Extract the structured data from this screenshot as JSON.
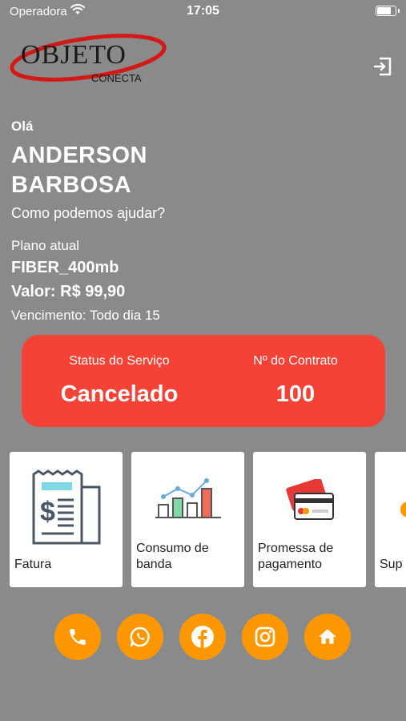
{
  "status_bar": {
    "carrier": "Operadora",
    "time": "17:05",
    "battery_level": 0.9
  },
  "logo": {
    "main": "OBJETO",
    "sub": "CONECTA"
  },
  "greeting": {
    "hello": "Olá",
    "name": "ANDERSON BARBOSA",
    "help": "Como podemos ajudar?"
  },
  "plan": {
    "label": "Plano atual",
    "name": "FIBER_400mb",
    "value": "Valor: R$ 99,90",
    "due": "Vencimento: Todo dia 15"
  },
  "status_card": {
    "status_label": "Status do Serviço",
    "status_value": "Cancelado",
    "contract_label": "Nº do Contrato",
    "contract_value": "100"
  },
  "tiles": [
    {
      "label": "Fatura",
      "icon": "invoice-icon"
    },
    {
      "label": "Consumo de banda",
      "icon": "bandwidth-chart-icon"
    },
    {
      "label": "Promessa de pagamento",
      "icon": "credit-card-icon"
    },
    {
      "label": "Sup",
      "icon": "support-icon"
    }
  ],
  "social": [
    "phone-icon",
    "whatsapp-icon",
    "facebook-icon",
    "instagram-icon",
    "home-icon"
  ],
  "colors": {
    "background": "#8a8a8a",
    "status_card": "#f44336",
    "social_button": "#ff9800",
    "tile": "#ffffff"
  }
}
